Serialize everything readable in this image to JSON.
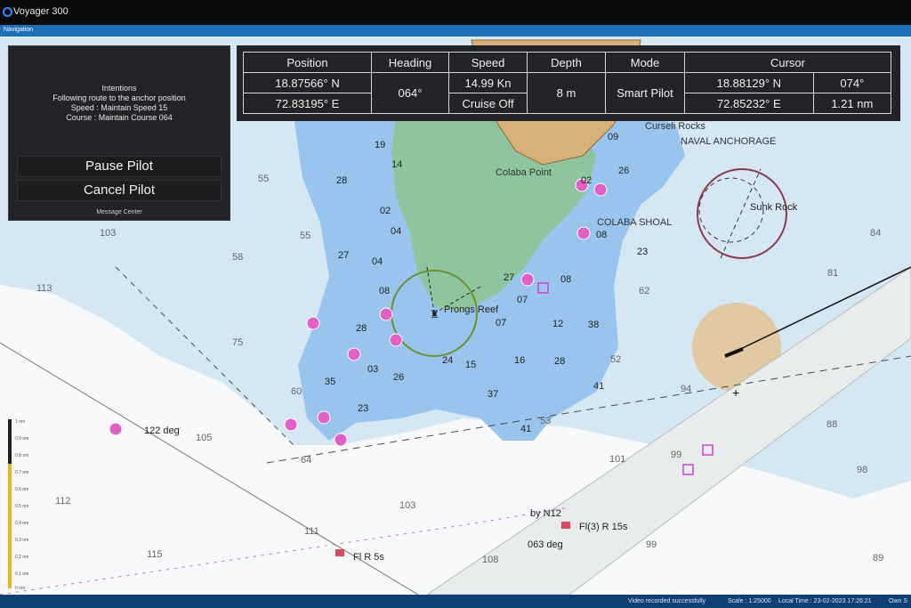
{
  "app": {
    "title": "Voyager 300",
    "nav_label": "Navigation"
  },
  "message_center": {
    "intent_title": "Intentions",
    "intent_line1": "Following route to the anchor position",
    "intent_line2": "Speed : Maintain Speed 15",
    "intent_line3": "Course : Maintain Course 064",
    "pause_label": "Pause Pilot",
    "cancel_label": "Cancel Pilot",
    "footer": "Message Center"
  },
  "info_panel": {
    "headers": {
      "position": "Position",
      "heading": "Heading",
      "speed": "Speed",
      "depth": "Depth",
      "mode": "Mode",
      "cursor": "Cursor"
    },
    "position_lat": "18.87566° N",
    "position_lon": "72.83195° E",
    "heading": "064°",
    "speed": "14.99 Kn",
    "cruise": "Cruise Off",
    "depth": "8 m",
    "mode": "Smart Pilot",
    "cursor_lat": "18.88129° N",
    "cursor_bearing": "074°",
    "cursor_lon": "72.85232° E",
    "cursor_range": "1.21 nm"
  },
  "map": {
    "labels": {
      "curseli": "Curseli Rocks",
      "naval": "NAVAL ANCHORAGE",
      "colaba_point": "Colaba Point",
      "colaba_shoal": "COLABA SHOAL",
      "sunk_rock": "Sunk Rock",
      "prongs_reef": "Prongs Reef",
      "deg122": "122 deg",
      "by_n12": "by N12",
      "fl3": "Fl(3) R 15s",
      "deg063": "063 deg",
      "flr5": "Fl R 5s"
    },
    "soundings": [
      {
        "v": "19"
      },
      {
        "v": "14"
      },
      {
        "v": "28"
      },
      {
        "v": "02"
      },
      {
        "v": "04"
      },
      {
        "v": "27"
      },
      {
        "v": "04"
      },
      {
        "v": "08"
      },
      {
        "v": "28"
      },
      {
        "v": "03"
      },
      {
        "v": "26"
      },
      {
        "v": "35"
      },
      {
        "v": "23"
      },
      {
        "v": "24"
      },
      {
        "v": "15"
      },
      {
        "v": "16"
      },
      {
        "v": "28"
      },
      {
        "v": "12"
      },
      {
        "v": "38"
      },
      {
        "v": "37"
      },
      {
        "v": "41"
      },
      {
        "v": "41"
      },
      {
        "v": "07"
      },
      {
        "v": "07"
      },
      {
        "v": "27"
      },
      {
        "v": "08"
      },
      {
        "v": "02"
      },
      {
        "v": "26"
      },
      {
        "v": "08"
      },
      {
        "v": "09"
      },
      {
        "v": "23"
      },
      {
        "v": "55"
      },
      {
        "v": "103"
      },
      {
        "v": "58"
      },
      {
        "v": "55"
      },
      {
        "v": "113"
      },
      {
        "v": "75"
      },
      {
        "v": "60"
      },
      {
        "v": "105"
      },
      {
        "v": "64"
      },
      {
        "v": "112"
      },
      {
        "v": "103"
      },
      {
        "v": "101"
      },
      {
        "v": "115"
      },
      {
        "v": "111"
      },
      {
        "v": "108"
      },
      {
        "v": "52"
      },
      {
        "v": "53"
      },
      {
        "v": "94"
      },
      {
        "v": "99"
      },
      {
        "v": "98"
      },
      {
        "v": "99"
      },
      {
        "v": "84"
      },
      {
        "v": "81"
      },
      {
        "v": "88"
      },
      {
        "v": "89"
      },
      {
        "v": "62"
      }
    ]
  },
  "status": {
    "video": "Video recorded successfully",
    "scale": "Scale : 1:25000",
    "local_time": "Local Time : 23-02-2023 17:26:21",
    "own": "Own S"
  },
  "scale_ticks": [
    "1 nm",
    "0.9 nm",
    "0.8 nm",
    "0.7 nm",
    "0.6 nm",
    "0.5 nm",
    "0.4 nm",
    "0.3 nm",
    "0.2 nm",
    "0.1 nm",
    "0 nm"
  ]
}
